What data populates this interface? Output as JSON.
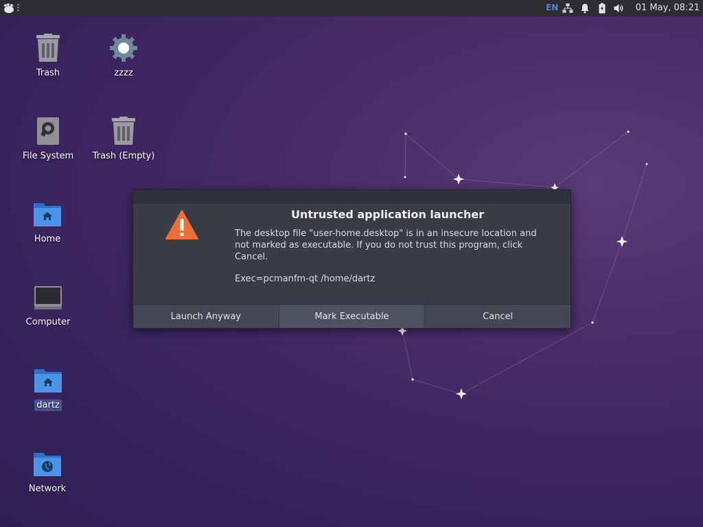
{
  "panel": {
    "menu_icon": "xfce-mouse-icon",
    "lang": "EN",
    "tray_icons": [
      "network-icon",
      "bell-icon",
      "battery-icon",
      "volume-icon"
    ],
    "clock": "01 May, 08:21",
    "lang_color": "#5a7fd9"
  },
  "desktop": {
    "icons": [
      {
        "label": "Trash",
        "icon": "trash-icon"
      },
      {
        "label": "zzzz",
        "icon": "gear-icon"
      },
      {
        "label": "File System",
        "icon": "drive-icon"
      },
      {
        "label": "Trash (Empty)",
        "icon": "trash-icon"
      },
      {
        "label": "Home",
        "icon": "home-folder-icon"
      },
      {
        "label": "Computer",
        "icon": "computer-icon"
      },
      {
        "label": "dartz",
        "icon": "home-folder-icon"
      },
      {
        "label": "Network",
        "icon": "network-folder-icon"
      }
    ]
  },
  "dialog": {
    "title": "Untrusted application launcher",
    "message": "The desktop file \"user-home.desktop\" is in an insecure location and not marked as executable. If you do not trust this program, click Cancel.",
    "exec": "Exec=pcmanfm-qt /home/dartz",
    "buttons": {
      "launch": "Launch Anyway",
      "mark": "Mark Executable",
      "cancel": "Cancel"
    },
    "warning_color": "#ef6e35"
  }
}
